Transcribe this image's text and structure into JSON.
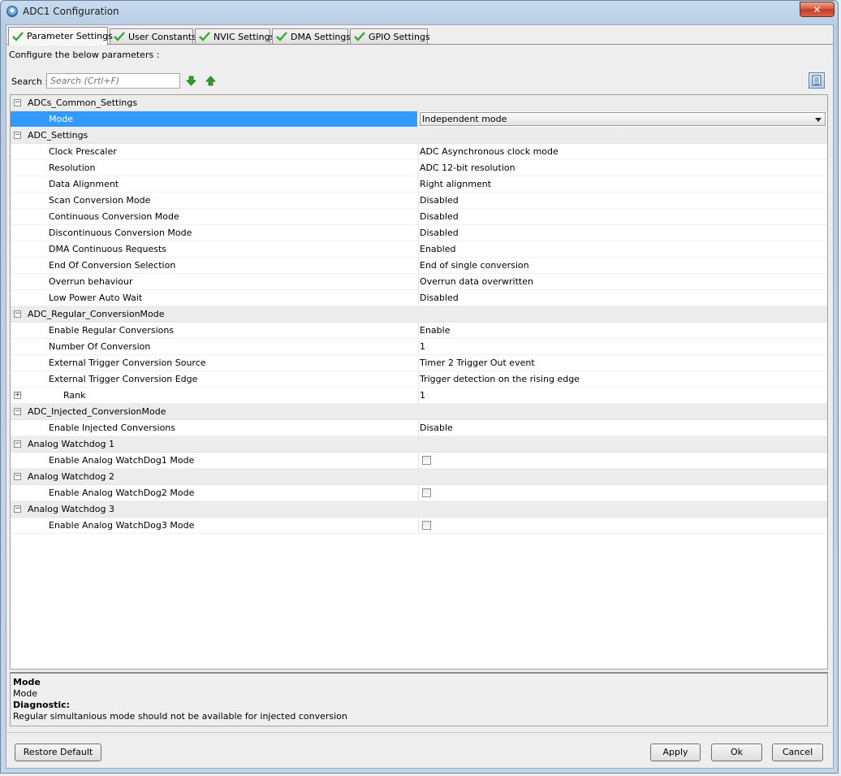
{
  "window": {
    "title": "ADC1 Configuration",
    "close_glyph": "✕"
  },
  "tabs": [
    {
      "label": "Parameter Settings",
      "active": true
    },
    {
      "label": "User Constants",
      "active": false
    },
    {
      "label": "NVIC Settings",
      "active": false
    },
    {
      "label": "DMA Settings",
      "active": false
    },
    {
      "label": "GPIO Settings",
      "active": false
    }
  ],
  "configure_text": "Configure the below parameters :",
  "search": {
    "label": "Search :",
    "placeholder": "Search (Crtl+F)"
  },
  "colors": {
    "selected_row": "#3399ff",
    "check_green": "#3aa52f",
    "arrow_green": "#2f9e2a"
  },
  "grid": {
    "rows": [
      {
        "type": "group",
        "label": "ADCs_Common_Settings"
      },
      {
        "type": "prop",
        "name": "Mode",
        "value": "Independent mode",
        "selected": true,
        "dropdown": true
      },
      {
        "type": "group",
        "label": "ADC_Settings"
      },
      {
        "type": "prop",
        "name": "Clock Prescaler",
        "value": "ADC Asynchronous clock mode"
      },
      {
        "type": "prop",
        "name": "Resolution",
        "value": "ADC 12-bit resolution"
      },
      {
        "type": "prop",
        "name": "Data Alignment",
        "value": "Right alignment"
      },
      {
        "type": "prop",
        "name": "Scan Conversion Mode",
        "value": "Disabled"
      },
      {
        "type": "prop",
        "name": "Continuous Conversion Mode",
        "value": "Disabled"
      },
      {
        "type": "prop",
        "name": "Discontinuous Conversion Mode",
        "value": "Disabled"
      },
      {
        "type": "prop",
        "name": "DMA Continuous Requests",
        "value": "Enabled"
      },
      {
        "type": "prop",
        "name": "End Of Conversion Selection",
        "value": "End of single conversion"
      },
      {
        "type": "prop",
        "name": "Overrun behaviour",
        "value": "Overrun data overwritten"
      },
      {
        "type": "prop",
        "name": "Low Power Auto Wait",
        "value": "Disabled"
      },
      {
        "type": "group",
        "label": "ADC_Regular_ConversionMode"
      },
      {
        "type": "prop",
        "name": "Enable Regular Conversions",
        "value": "Enable"
      },
      {
        "type": "prop",
        "name": "Number Of Conversion",
        "value": "1"
      },
      {
        "type": "prop",
        "name": "External Trigger Conversion Source",
        "value": "Timer 2 Trigger Out event"
      },
      {
        "type": "prop",
        "name": "External Trigger Conversion Edge",
        "value": "Trigger detection on the rising edge"
      },
      {
        "type": "prop",
        "name": "Rank",
        "value": "1",
        "expandable": true
      },
      {
        "type": "group",
        "label": "ADC_Injected_ConversionMode"
      },
      {
        "type": "prop",
        "name": "Enable Injected Conversions",
        "value": "Disable"
      },
      {
        "type": "group",
        "label": "Analog Watchdog 1"
      },
      {
        "type": "prop",
        "name": "Enable Analog WatchDog1 Mode",
        "checkbox": true,
        "checked": false
      },
      {
        "type": "group",
        "label": "Analog Watchdog 2"
      },
      {
        "type": "prop",
        "name": "Enable Analog WatchDog2 Mode",
        "checkbox": true,
        "checked": false
      },
      {
        "type": "group",
        "label": "Analog Watchdog 3"
      },
      {
        "type": "prop",
        "name": "Enable Analog WatchDog3 Mode",
        "checkbox": true,
        "checked": false
      }
    ]
  },
  "description": {
    "title": "Mode",
    "text": "Mode",
    "diagnostic_label": "Diagnostic:",
    "diagnostic_text": "Regular simultanious mode should not be available for injected conversion"
  },
  "buttons": {
    "restore_default": "Restore Default",
    "apply": "Apply",
    "ok": "Ok",
    "cancel": "Cancel"
  }
}
